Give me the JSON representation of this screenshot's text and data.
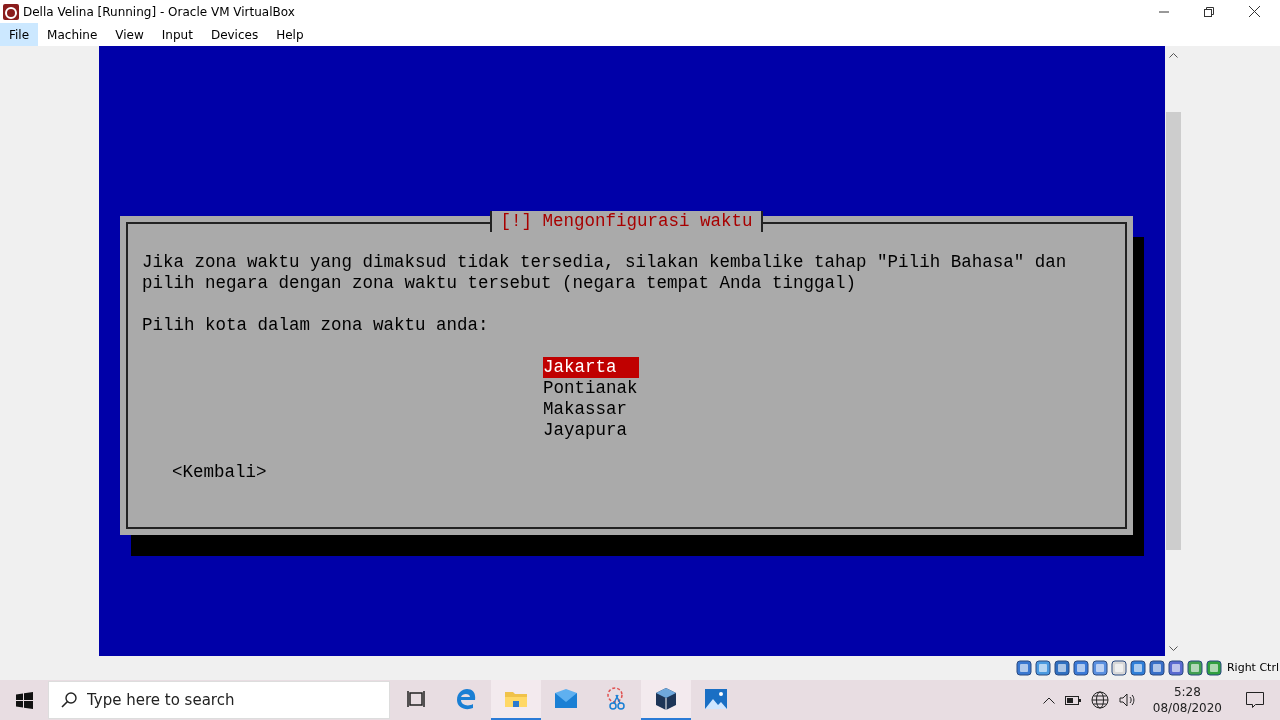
{
  "window": {
    "title": "Della Velina [Running] - Oracle VM VirtualBox"
  },
  "menu": [
    {
      "label": "File",
      "selected": true
    },
    {
      "label": "Machine",
      "selected": false
    },
    {
      "label": "View",
      "selected": false
    },
    {
      "label": "Input",
      "selected": false
    },
    {
      "label": "Devices",
      "selected": false
    },
    {
      "label": "Help",
      "selected": false
    }
  ],
  "dialog": {
    "title": "[!] Mengonfigurasi waktu",
    "message": [
      "Jika zona waktu yang dimaksud tidak tersedia, silakan kembalike tahap \"Pilih Bahasa\" dan",
      "pilih negara dengan zona waktu tersebut (negara tempat Anda tinggal)"
    ],
    "prompt": "Pilih kota dalam zona waktu anda:",
    "options": [
      {
        "label": "Jakarta",
        "selected": true
      },
      {
        "label": "Pontianak",
        "selected": false
      },
      {
        "label": "Makassar",
        "selected": false
      },
      {
        "label": "Jayapura",
        "selected": false
      }
    ],
    "back_button": "<Kembali>"
  },
  "status_bar": {
    "host_key": "Right Ctrl"
  },
  "taskbar": {
    "search": {
      "placeholder": "Type here to search"
    },
    "apps": [
      {
        "kind": "taskview",
        "active": false
      },
      {
        "kind": "edge",
        "active": false
      },
      {
        "kind": "folder",
        "active": true
      },
      {
        "kind": "mail",
        "active": false
      },
      {
        "kind": "snip",
        "active": false
      },
      {
        "kind": "virtualbox",
        "active": true
      },
      {
        "kind": "photos",
        "active": false
      }
    ],
    "time": "5:28",
    "date": "08/08/2020"
  }
}
